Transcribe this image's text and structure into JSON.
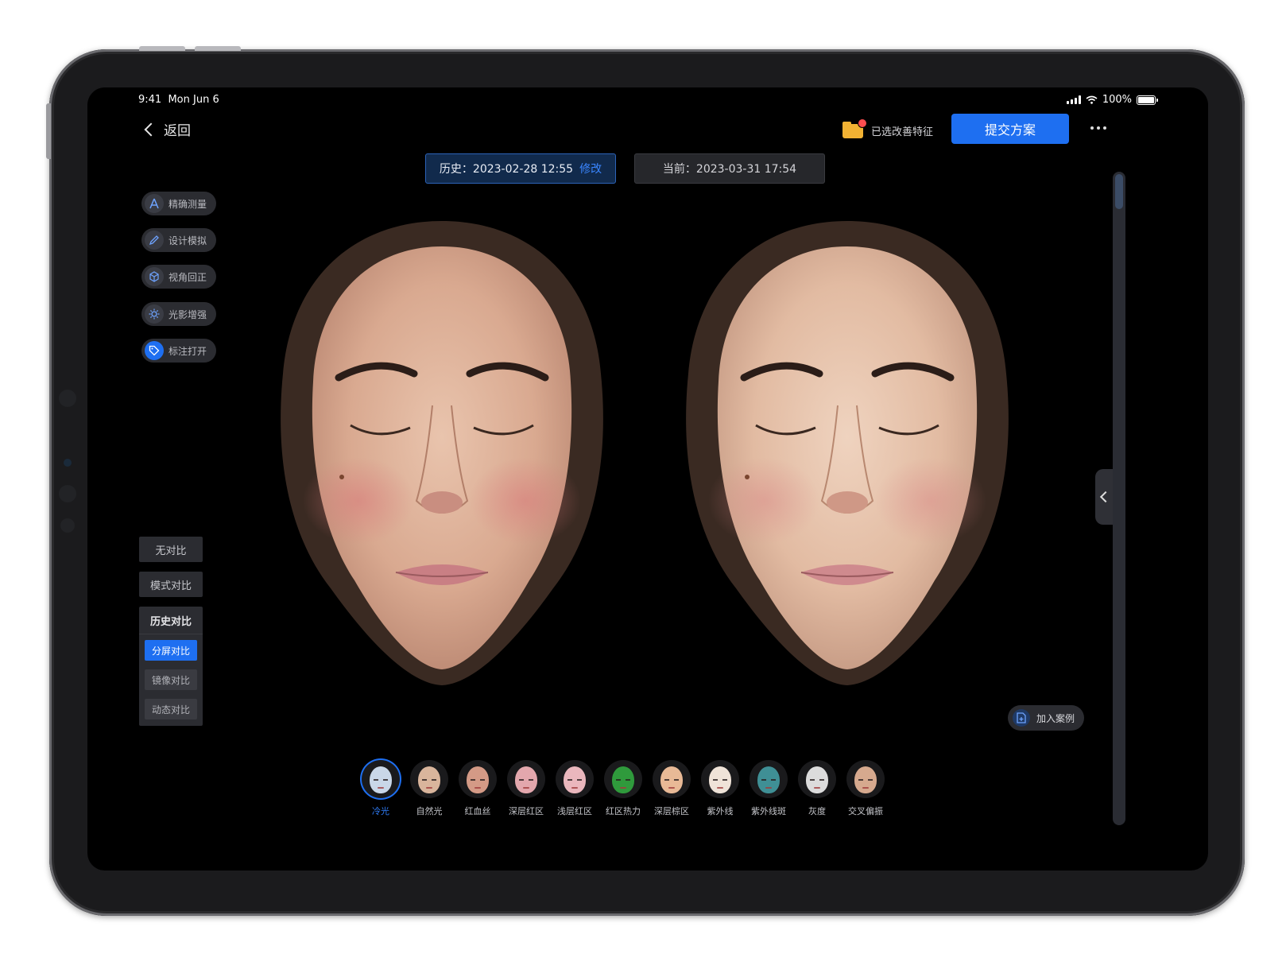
{
  "status_bar": {
    "time": "9:41",
    "date": "Mon Jun 6",
    "battery": "100%"
  },
  "header": {
    "back_label": "返回",
    "selected_features_label": "已选改善特征",
    "submit_label": "提交方案"
  },
  "dates": {
    "history_label": "历史：2023-02-28 12:55",
    "history_edit": "修改",
    "current_label": "当前：2023-03-31 17:54"
  },
  "tools": [
    {
      "label": "精确测量",
      "icon": "ruler-icon"
    },
    {
      "label": "设计模拟",
      "icon": "pencil-icon"
    },
    {
      "label": "视角回正",
      "icon": "rotate-view-icon"
    },
    {
      "label": "光影增强",
      "icon": "sun-icon"
    },
    {
      "label": "标注打开",
      "icon": "tag-icon",
      "active": true
    }
  ],
  "compare": {
    "none": "无对比",
    "mode": "模式对比",
    "history": "历史对比",
    "split": "分屏对比",
    "mirror": "镜像对比",
    "dynamic": "动态对比",
    "selected": "分屏对比"
  },
  "add_case_label": "加入案例",
  "filters": [
    {
      "label": "冷光",
      "color": "#c9d7e8",
      "selected": true
    },
    {
      "label": "自然光",
      "color": "#d9b59c"
    },
    {
      "label": "红血丝",
      "color": "#d49a86"
    },
    {
      "label": "深层红区",
      "color": "#e3a7ad"
    },
    {
      "label": "浅层红区",
      "color": "#eab7bd"
    },
    {
      "label": "红区热力",
      "color": "#2f9a3c"
    },
    {
      "label": "深层棕区",
      "color": "#e8b996"
    },
    {
      "label": "紫外线",
      "color": "#efe3d8"
    },
    {
      "label": "紫外线斑",
      "color": "#3f8f95"
    },
    {
      "label": "灰度",
      "color": "#dcdcdc"
    },
    {
      "label": "交叉偏振",
      "color": "#d6a98e"
    }
  ],
  "colors": {
    "accent": "#1e6ff1",
    "panel": "#2b2c31",
    "badge": "#ff4d4f",
    "folder": "#f2b233"
  }
}
